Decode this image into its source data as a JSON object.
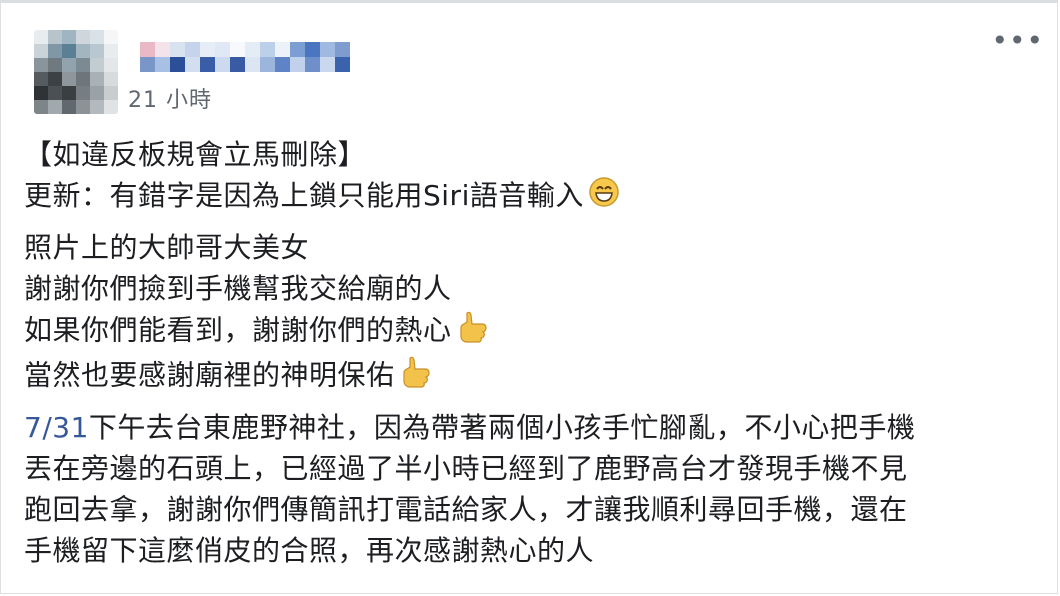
{
  "post": {
    "timestamp": "21 小時",
    "more_menu_label": "•••",
    "line1": "【如違反板規會立馬刪除】",
    "line2": "更新：有錯字是因為上鎖只能用Siri語音輸入",
    "line3": "照片上的大帥哥大美女",
    "line4": "謝謝你們撿到手機幫我交給廟的人",
    "line5": "如果你們能看到，謝謝你們的熱心",
    "line6": "當然也要感謝廟裡的神明保佑",
    "line7_date": "7/31",
    "line7_rest": "下午去台東鹿野神社，因為帶著兩個小孩手忙腳亂，不小心把手機",
    "line8": "丟在旁邊的石頭上，已經過了半小時已經到了鹿野高台才發現手機不見",
    "line9": "跑回去拿，謝謝你們傳簡訊打電話給家人，才讓我順利尋回手機，還在",
    "line10": "手機留下這麼俏皮的合照，再次感謝熱心的人"
  },
  "icons": {
    "smile": "grinning-face-emoji",
    "thumb": "pointing-hand-emoji"
  }
}
